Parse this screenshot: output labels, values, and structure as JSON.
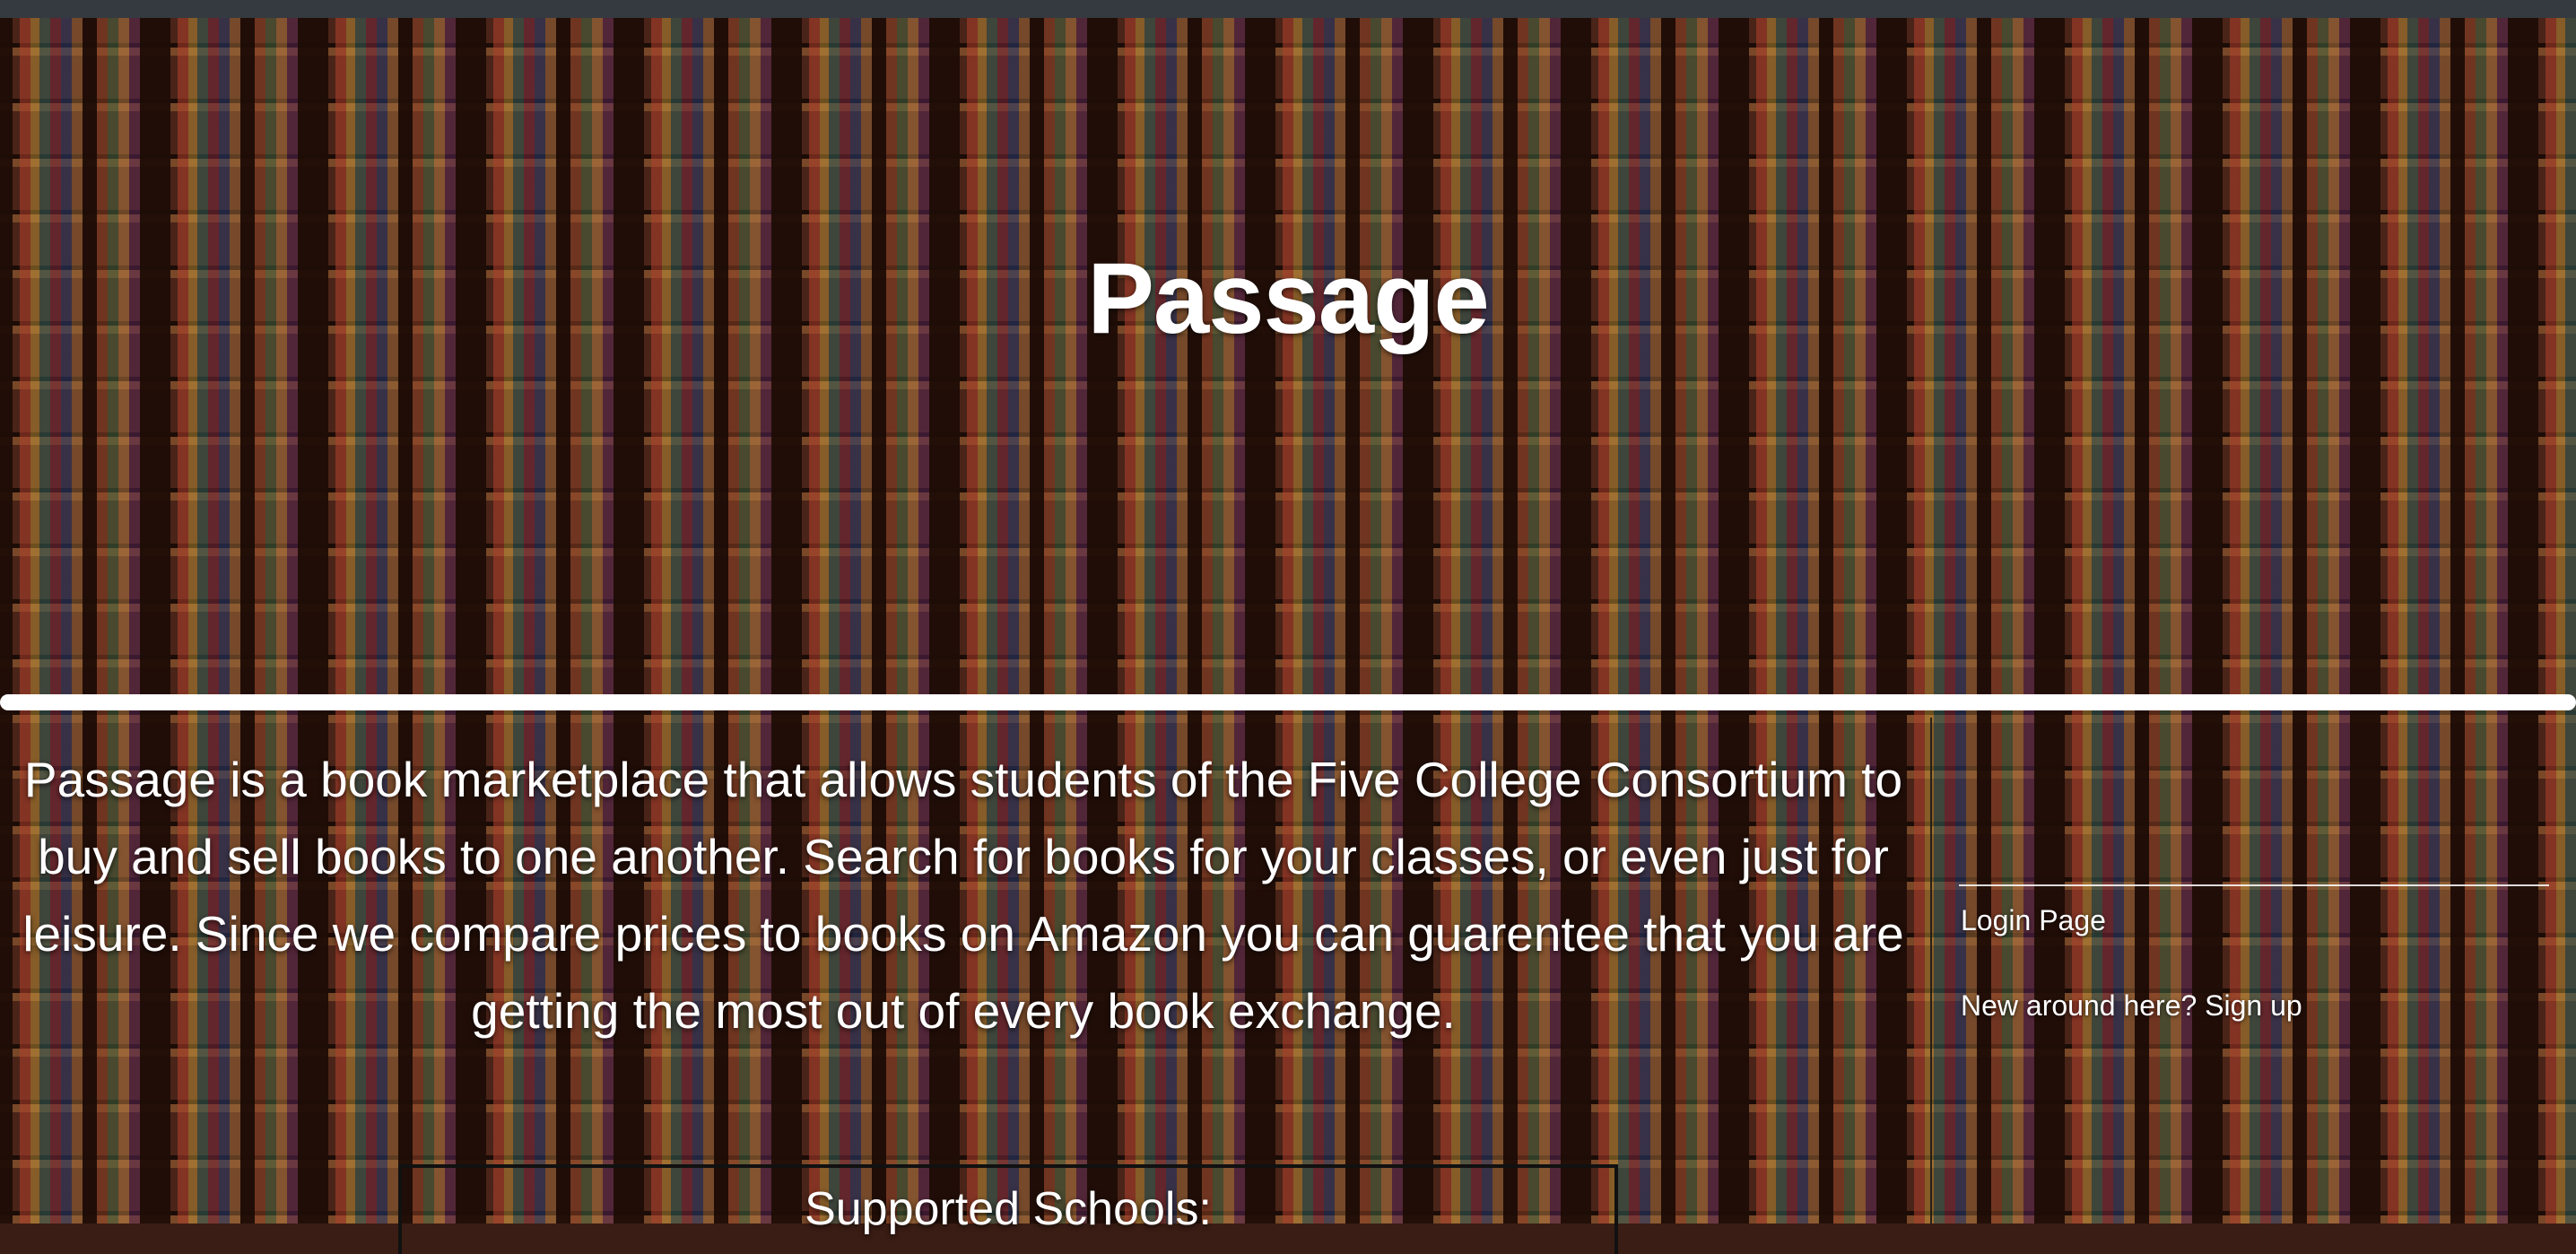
{
  "site": {
    "title": "Passage"
  },
  "intro": {
    "text": "Passage is a book marketplace that allows students of the Five College Consortium to buy and sell books to one another. Search for books for your classes, or even just for leisure. Since we compare prices to books on Amazon you can guarentee that you are getting the most out of every book exchange."
  },
  "sidebar": {
    "login_label": "Login Page",
    "signup_label": "New around here? Sign up"
  },
  "schools": {
    "heading": "Supported Schools:"
  },
  "colors": {
    "topbar": "#343a40",
    "text": "#ffffff",
    "divider": "#ffffff"
  }
}
